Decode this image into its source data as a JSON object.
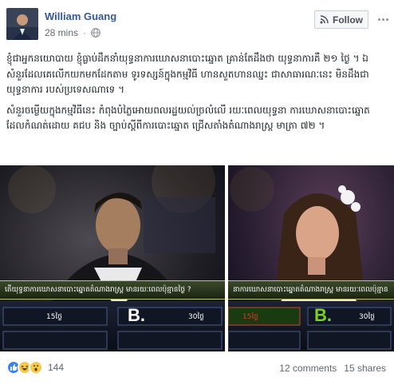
{
  "post": {
    "author": "William Guang",
    "timestamp": "28 mins",
    "privacy_icon": "globe-icon",
    "follow_label": "Follow",
    "paragraphs": [
      "ខ្ញុំជាអ្នកនយោបាយ ខ្ញុំធ្លាប់ដឹកនាំយុទ្ធនាការឃោសនាបោះឆ្នោត គ្រាន់តែដឹងថា យុទ្ធនាការគឺ ២១ ថ្ងៃ ។ ឯ សំនួរដែលគេលើកយកមកដែកតាម ទូរទស្សន៍ក្នុងកម្មវិធី ហានសួតហានឈ្នះ ជាសាធារណៈនេះ មិនដឹងជាយុទ្ធនាការ របស់ប្រទេសណាទេ ។",
      "សំនួរចម្លើយក្នុងកម្មវិធីនេះ កំពុងបំភ្លៃអោយពលរដ្ឋយល់ច្រលំលើ រយៈពេលយុទ្ធនា ការឃោសនាបោះឆ្នោត ដែលកំណត់ដោយ គជប និង ច្បាប់ស្ដីពីការបោះឆ្នោត ជ្រើសតាំងតំណាងរាស្ត្រ មាត្រា ៧២ ។"
    ]
  },
  "images": {
    "left": {
      "question": "តើយុទ្ធនាការឃោសនាបោះឆ្នោតតំណាងរាស្ត្រ មានរយៈពេលប៉ុន្មានថ្ងៃ ?",
      "option_left": "15ថ្ងៃ",
      "option_b": "B.",
      "option_right": "30ថ្ងៃ"
    },
    "right": {
      "question": "នាការឃោសនាបោះឆ្នោតតំណាងរាស្ត្រ មានរយៈពេលប៉ុន្មាន",
      "option_left": "15ថ្ងៃ",
      "option_b": "B.",
      "option_right": "30ថ្ងៃ"
    }
  },
  "footer": {
    "reaction_icons": [
      "like-icon",
      "haha-icon",
      "wow-icon"
    ],
    "reaction_count": "144",
    "comments": "12 comments",
    "shares": "15 shares"
  },
  "colors": {
    "link": "#365899",
    "secondary_text": "#616770",
    "like_blue": "#3b82f6",
    "answer_green": "#7cd11e"
  }
}
